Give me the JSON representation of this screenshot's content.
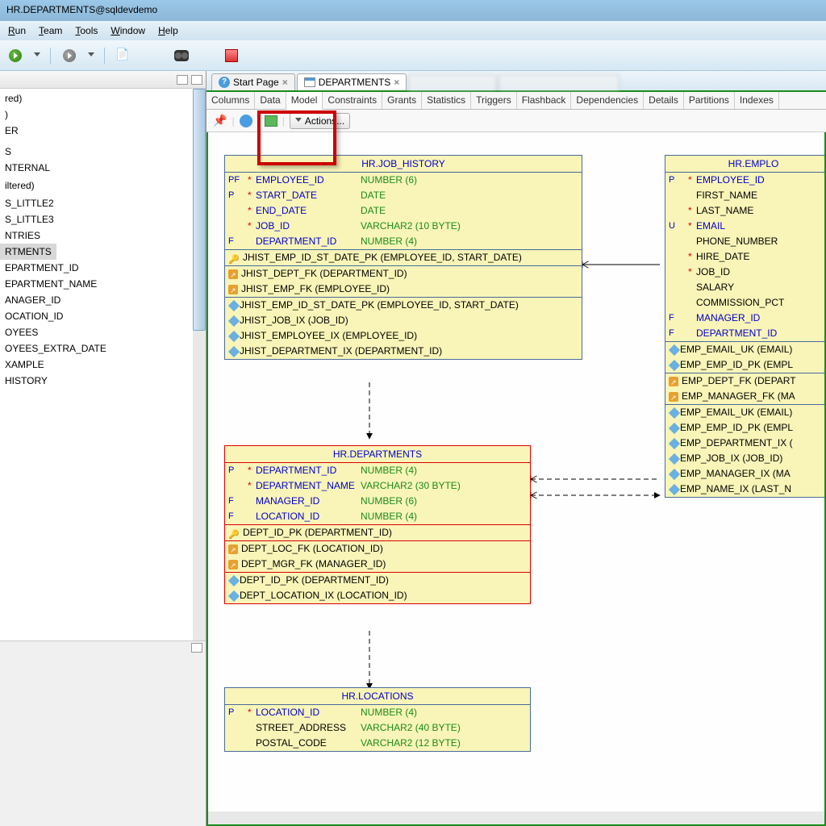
{
  "title": "HR.DEPARTMENTS@sqldevdemo",
  "menu": {
    "run": "Run",
    "team": "Team",
    "tools": "Tools",
    "window": "Window",
    "help": "Help"
  },
  "tree": {
    "items": [
      "red)",
      ")",
      "ER",
      "",
      "",
      "",
      "S",
      "NTERNAL",
      "",
      "iltered)",
      "",
      "S_LITTLE2",
      "S_LITTLE3",
      "NTRIES",
      "RTMENTS",
      "EPARTMENT_ID",
      "EPARTMENT_NAME",
      "ANAGER_ID",
      "OCATION_ID",
      "OYEES",
      "OYEES_EXTRA_DATE",
      "XAMPLE",
      "HISTORY"
    ],
    "selected_index": 14
  },
  "tabs": {
    "start": "Start Page",
    "departments": "DEPARTMENTS"
  },
  "sub_tabs": [
    "Columns",
    "Data",
    "Model",
    "Constraints",
    "Grants",
    "Statistics",
    "Triggers",
    "Flashback",
    "Dependencies",
    "Details",
    "Partitions",
    "Indexes"
  ],
  "actions_label": "Actions...",
  "entities": {
    "job_history": {
      "title": "HR.JOB_HISTORY",
      "cols": [
        {
          "key": "PF",
          "star": "*",
          "name": "EMPLOYEE_ID",
          "type": "NUMBER (6)"
        },
        {
          "key": "P",
          "star": "*",
          "name": "START_DATE",
          "type": "DATE"
        },
        {
          "key": "",
          "star": "*",
          "name": "END_DATE",
          "type": "DATE"
        },
        {
          "key": "",
          "star": "*",
          "name": "JOB_ID",
          "type": "VARCHAR2 (10 BYTE)"
        },
        {
          "key": "F",
          "star": "",
          "name": "DEPARTMENT_ID",
          "type": "NUMBER (4)"
        }
      ],
      "pk": "JHIST_EMP_ID_ST_DATE_PK (EMPLOYEE_ID, START_DATE)",
      "fks": [
        "JHIST_DEPT_FK (DEPARTMENT_ID)",
        "JHIST_EMP_FK (EMPLOYEE_ID)"
      ],
      "idx": [
        "JHIST_EMP_ID_ST_DATE_PK (EMPLOYEE_ID, START_DATE)",
        "JHIST_JOB_IX (JOB_ID)",
        "JHIST_EMPLOYEE_IX (EMPLOYEE_ID)",
        "JHIST_DEPARTMENT_IX (DEPARTMENT_ID)"
      ]
    },
    "departments": {
      "title": "HR.DEPARTMENTS",
      "cols": [
        {
          "key": "P",
          "star": "*",
          "name": "DEPARTMENT_ID",
          "type": "NUMBER (4)"
        },
        {
          "key": "",
          "star": "*",
          "name": "DEPARTMENT_NAME",
          "type": "VARCHAR2 (30 BYTE)"
        },
        {
          "key": "F",
          "star": "",
          "name": "MANAGER_ID",
          "type": "NUMBER (6)"
        },
        {
          "key": "F",
          "star": "",
          "name": "LOCATION_ID",
          "type": "NUMBER (4)"
        }
      ],
      "pk": "DEPT_ID_PK (DEPARTMENT_ID)",
      "fks": [
        "DEPT_LOC_FK (LOCATION_ID)",
        "DEPT_MGR_FK (MANAGER_ID)"
      ],
      "idx": [
        "DEPT_ID_PK (DEPARTMENT_ID)",
        "DEPT_LOCATION_IX (LOCATION_ID)"
      ]
    },
    "locations": {
      "title": "HR.LOCATIONS",
      "cols": [
        {
          "key": "P",
          "star": "*",
          "name": "LOCATION_ID",
          "type": "NUMBER (4)"
        },
        {
          "key": "",
          "star": "",
          "name": "STREET_ADDRESS",
          "type": "VARCHAR2 (40 BYTE)"
        },
        {
          "key": "",
          "star": "",
          "name": "POSTAL_CODE",
          "type": "VARCHAR2 (12 BYTE)"
        }
      ]
    },
    "employees": {
      "title": "HR.EMPLO",
      "cols": [
        {
          "key": "P",
          "star": "*",
          "name": "EMPLOYEE_ID",
          "type": ""
        },
        {
          "key": "",
          "star": "",
          "name": "FIRST_NAME",
          "type": ""
        },
        {
          "key": "",
          "star": "*",
          "name": "LAST_NAME",
          "type": ""
        },
        {
          "key": "U",
          "star": "*",
          "name": "EMAIL",
          "type": ""
        },
        {
          "key": "",
          "star": "",
          "name": "PHONE_NUMBER",
          "type": ""
        },
        {
          "key": "",
          "star": "*",
          "name": "HIRE_DATE",
          "type": ""
        },
        {
          "key": "",
          "star": "*",
          "name": "JOB_ID",
          "type": ""
        },
        {
          "key": "",
          "star": "",
          "name": "SALARY",
          "type": ""
        },
        {
          "key": "",
          "star": "",
          "name": "COMMISSION_PCT",
          "type": ""
        },
        {
          "key": "F",
          "star": "",
          "name": "MANAGER_ID",
          "type": ""
        },
        {
          "key": "F",
          "star": "",
          "name": "DEPARTMENT_ID",
          "type": ""
        }
      ],
      "uks": [
        "EMP_EMAIL_UK (EMAIL)",
        "EMP_EMP_ID_PK (EMPL"
      ],
      "fks": [
        "EMP_DEPT_FK (DEPART",
        "EMP_MANAGER_FK (MA"
      ],
      "idx": [
        "EMP_EMAIL_UK (EMAIL)",
        "EMP_EMP_ID_PK (EMPL",
        "EMP_DEPARTMENT_IX (",
        "EMP_JOB_IX (JOB_ID)",
        "EMP_MANAGER_IX (MA",
        "EMP_NAME_IX (LAST_N"
      ]
    }
  }
}
